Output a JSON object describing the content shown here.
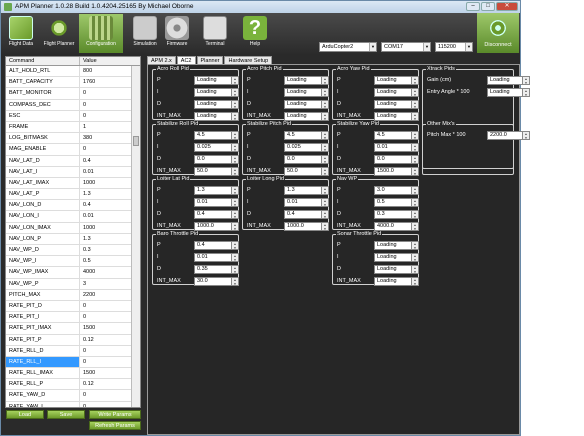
{
  "window": {
    "title": "APM Planner 1.0.28 Build 1.0.4204.25165 By Michael Oborne"
  },
  "window_controls": {
    "minimize": "–",
    "maximize": "□",
    "close": "✕"
  },
  "toolbar": {
    "buttons": [
      {
        "label": "Flight Data",
        "icon": "flight-data-icon"
      },
      {
        "label": "Flight Planner",
        "icon": "flight-planner-icon"
      },
      {
        "label": "Configuration",
        "icon": "configuration-icon"
      },
      {
        "label": "Simulation",
        "icon": "simulation-icon"
      },
      {
        "label": "Firmware",
        "icon": "firmware-icon"
      },
      {
        "label": "Terminal",
        "icon": "terminal-icon"
      },
      {
        "label": "Help",
        "icon": "help-icon"
      }
    ],
    "help_glyph": "?",
    "vehicle": "ArduCopter2",
    "port": "COM17",
    "baud": "115200",
    "disconnect": "Disconnect"
  },
  "params": {
    "header_command": "Command",
    "header_value": "Value",
    "rows": [
      {
        "c": "ALT_HOLD_RTL",
        "v": "800"
      },
      {
        "c": "BATT_CAPACITY",
        "v": "1760"
      },
      {
        "c": "BATT_MONITOR",
        "v": "0"
      },
      {
        "c": "COMPASS_DEC",
        "v": "0"
      },
      {
        "c": "ESC",
        "v": "0"
      },
      {
        "c": "FRAME",
        "v": "1"
      },
      {
        "c": "LOG_BITMASK",
        "v": "380"
      },
      {
        "c": "MAG_ENABLE",
        "v": "0"
      },
      {
        "c": "NAV_LAT_D",
        "v": "0.4"
      },
      {
        "c": "NAV_LAT_I",
        "v": "0.01"
      },
      {
        "c": "NAV_LAT_IMAX",
        "v": "1000"
      },
      {
        "c": "NAV_LAT_P",
        "v": "1.3"
      },
      {
        "c": "NAV_LON_D",
        "v": "0.4"
      },
      {
        "c": "NAV_LON_I",
        "v": "0.01"
      },
      {
        "c": "NAV_LON_IMAX",
        "v": "1000"
      },
      {
        "c": "NAV_LON_P",
        "v": "1.3"
      },
      {
        "c": "NAV_WP_D",
        "v": "0.3"
      },
      {
        "c": "NAV_WP_I",
        "v": "0.5"
      },
      {
        "c": "NAV_WP_IMAX",
        "v": "4000"
      },
      {
        "c": "NAV_WP_P",
        "v": "3"
      },
      {
        "c": "PITCH_MAX",
        "v": "2200"
      },
      {
        "c": "RATE_PIT_D",
        "v": "0"
      },
      {
        "c": "RATE_PIT_I",
        "v": "0"
      },
      {
        "c": "RATE_PIT_IMAX",
        "v": "1500"
      },
      {
        "c": "RATE_PIT_P",
        "v": "0.12"
      },
      {
        "c": "RATE_RLL_D",
        "v": "0"
      },
      {
        "c": "RATE_RLL_I",
        "v": "0"
      },
      {
        "c": "RATE_RLL_IMAX",
        "v": "1500"
      },
      {
        "c": "RATE_RLL_P",
        "v": "0.12"
      },
      {
        "c": "RATE_YAW_D",
        "v": "0"
      },
      {
        "c": "RATE_YAW_I",
        "v": "0"
      }
    ],
    "selected_row": "RATE_RLL_I"
  },
  "left_buttons": {
    "load": "Load",
    "save": "Save",
    "write": "Write Params",
    "refresh": "Refresh Params"
  },
  "tabs": [
    "APM 2.x",
    "AC2",
    "Planner",
    "Hardware Setup"
  ],
  "spinner": {
    "up": "▲",
    "down": "▼"
  },
  "groups": [
    {
      "title": "Acro Roll Pid",
      "fields": [
        [
          "P",
          "Loading"
        ],
        [
          "I",
          "Loading"
        ],
        [
          "D",
          "Loading"
        ],
        [
          "INT_MAX",
          "Loading"
        ]
      ]
    },
    {
      "title": "Acro Pitch Pid",
      "fields": [
        [
          "P",
          "Loading"
        ],
        [
          "I",
          "Loading"
        ],
        [
          "D",
          "Loading"
        ],
        [
          "INT_MAX",
          "Loading"
        ]
      ]
    },
    {
      "title": "Acro Yaw Pid",
      "fields": [
        [
          "P",
          "Loading"
        ],
        [
          "I",
          "Loading"
        ],
        [
          "D",
          "Loading"
        ],
        [
          "INT_MAX",
          "Loading"
        ]
      ]
    },
    {
      "title": "Xtrack Pids",
      "fields": [
        [
          "Gain (cm)",
          "Loading"
        ],
        [
          "Entry Angle * 100",
          "Loading"
        ]
      ]
    },
    {
      "title": "Stabilize Roll Pid",
      "fields": [
        [
          "P",
          "4.5"
        ],
        [
          "I",
          "0.025"
        ],
        [
          "D",
          "0.0"
        ],
        [
          "INT_MAX",
          "50.0"
        ]
      ]
    },
    {
      "title": "Stabilize Pitch Pid",
      "fields": [
        [
          "P",
          "4.5"
        ],
        [
          "I",
          "0.025"
        ],
        [
          "D",
          "0.0"
        ],
        [
          "INT_MAX",
          "50.0"
        ]
      ]
    },
    {
      "title": "Stabilize Yaw Pid",
      "fields": [
        [
          "P",
          "4.5"
        ],
        [
          "I",
          "0.01"
        ],
        [
          "D",
          "0.0"
        ],
        [
          "INT_MAX",
          "1500.0"
        ]
      ]
    },
    {
      "title": "Other Mix's",
      "fields": [
        [
          "Pitch Max * 100",
          "2200.0"
        ]
      ]
    },
    {
      "title": "Loiter Lat Pid",
      "fields": [
        [
          "P",
          "1.3"
        ],
        [
          "I",
          "0.01"
        ],
        [
          "D",
          "0.4"
        ],
        [
          "INT_MAX",
          "1000.0"
        ]
      ]
    },
    {
      "title": "Loiter Long Pid",
      "fields": [
        [
          "P",
          "1.3"
        ],
        [
          "I",
          "0.01"
        ],
        [
          "D",
          "0.4"
        ],
        [
          "INT_MAX",
          "1000.0"
        ]
      ]
    },
    {
      "title": "Nav WP",
      "fields": [
        [
          "P",
          "3.0"
        ],
        [
          "I",
          "0.5"
        ],
        [
          "D",
          "0.3"
        ],
        [
          "INT_MAX",
          "4000.0"
        ]
      ]
    },
    {
      "title": "Baro Throttle Pid",
      "fields": [
        [
          "P",
          "0.4"
        ],
        [
          "I",
          "0.01"
        ],
        [
          "D",
          "0.35"
        ],
        [
          "INT_MAX",
          "30.0"
        ]
      ]
    },
    {
      "title": "Sonar Throttle Pid",
      "fields": [
        [
          "P",
          "Loading"
        ],
        [
          "I",
          "Loading"
        ],
        [
          "D",
          "Loading"
        ],
        [
          "INT_MAX",
          "Loading"
        ]
      ]
    }
  ]
}
